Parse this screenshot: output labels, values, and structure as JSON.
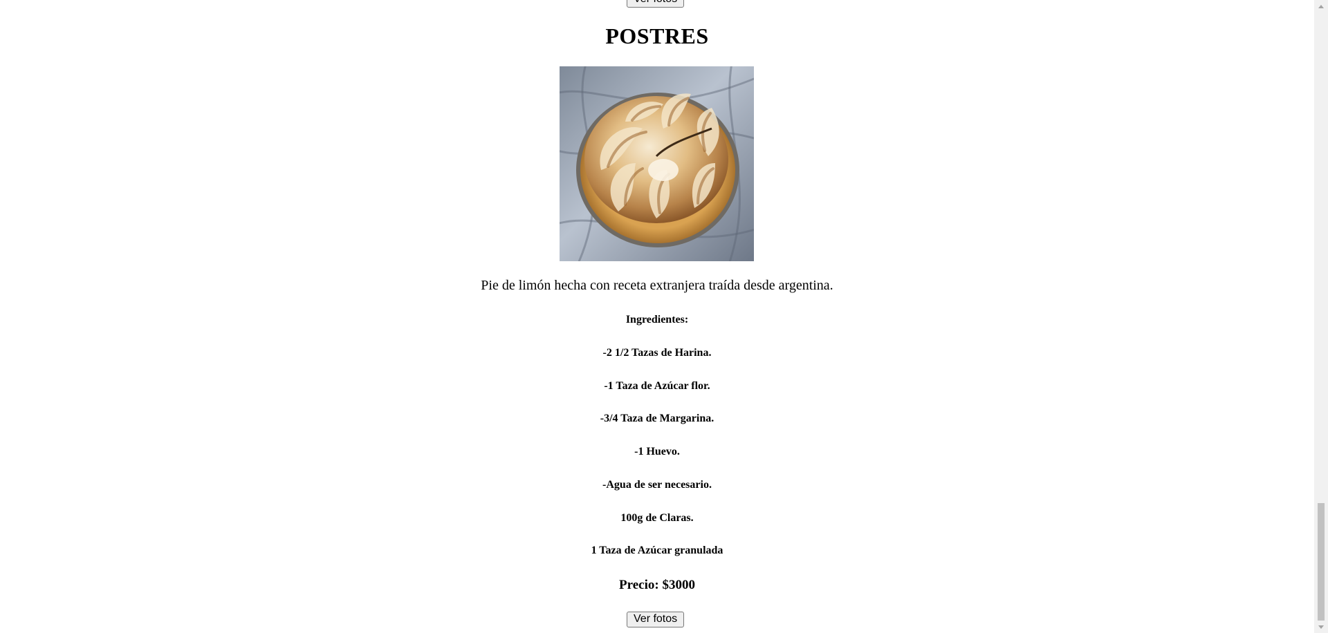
{
  "top_button_label": "Ver fotos",
  "section": {
    "title": "POSTRES",
    "image_alt": "Pie de limón con merengue",
    "description": "Pie de limón hecha con receta extranjera traída desde argentina.",
    "ingredients_heading": "Ingredientes:",
    "ingredients": [
      "-2 1/2 Tazas de Harina.",
      "-1 Taza de Azúcar flor.",
      "-3/4 Taza de Margarina.",
      "-1 Huevo.",
      "-Agua de ser necesario.",
      "100g de Claras.",
      "1 Taza de Azúcar granulada"
    ],
    "price": "Precio: $3000",
    "button_label": "Ver fotos"
  },
  "scrollbar": {
    "up_icon": "arrow-up-icon",
    "down_icon": "arrow-down-icon"
  }
}
